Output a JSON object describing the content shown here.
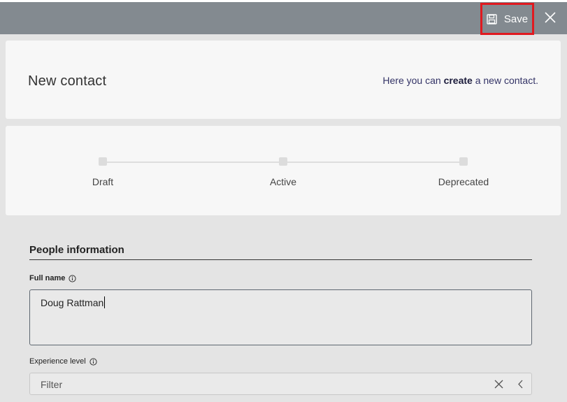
{
  "toolbar": {
    "save_label": "Save",
    "save_icon": "floppy-disk-icon",
    "close_icon": "close-icon",
    "highlight_color": "#e0191f",
    "bar_color": "#838a90"
  },
  "header": {
    "title": "New contact",
    "hint_prefix": "Here you can ",
    "hint_emphasis": "create",
    "hint_suffix": " a new contact."
  },
  "stages": [
    {
      "label": "Draft"
    },
    {
      "label": "Active"
    },
    {
      "label": "Deprecated"
    }
  ],
  "form": {
    "section_title": "People information",
    "full_name": {
      "label": "Full name",
      "value": "Doug Rattman"
    },
    "experience_level": {
      "label": "Experience level",
      "placeholder": "Filter"
    }
  }
}
